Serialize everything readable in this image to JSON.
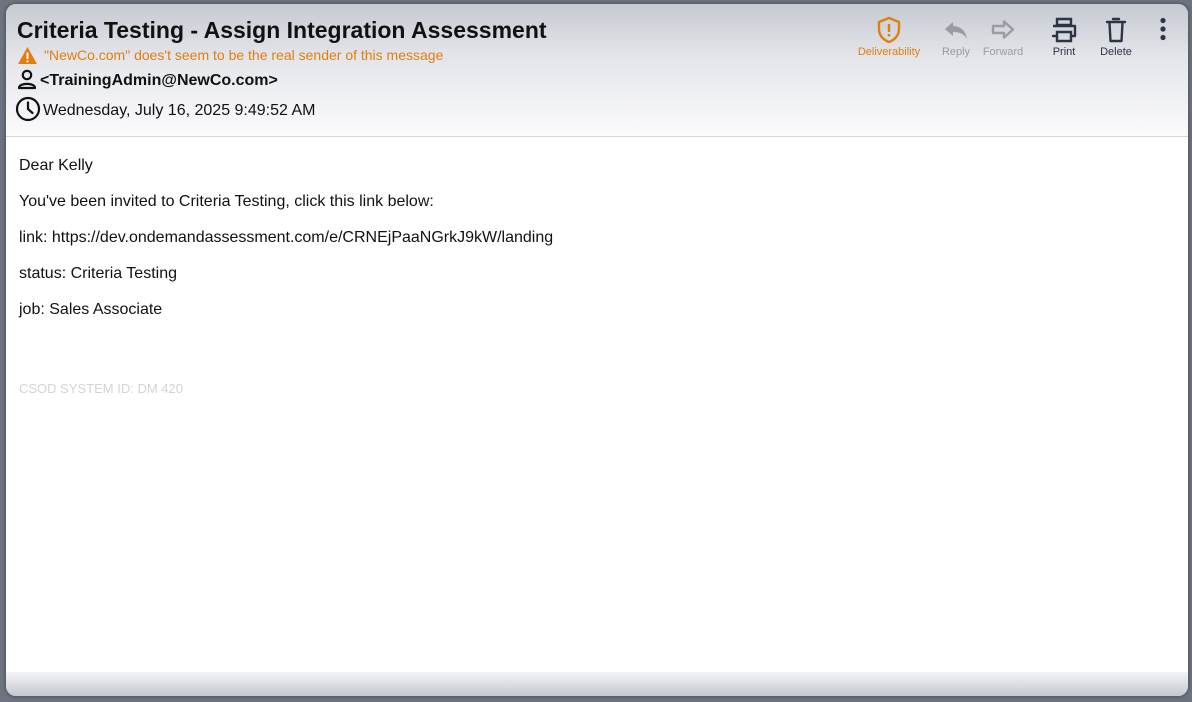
{
  "email": {
    "subject": "Criteria Testing - Assign Integration Assessment",
    "warning": "\"NewCo.com\" does't seem to be the real sender of this message",
    "sender": "<TrainingAdmin@NewCo.com>",
    "date": "Wednesday, July 16, 2025 9:49:52 AM"
  },
  "toolbar": {
    "deliverability_label": "Deliverability",
    "reply_label": "Reply",
    "forward_label": "Forward",
    "print_label": "Print",
    "delete_label": "Delete"
  },
  "body": {
    "greeting": "Dear Kelly",
    "invite": "You've been invited to Criteria Testing, click this link below:",
    "link_line": "link: https://dev.ondemandassessment.com/e/CRNEjPaaNGrkJ9kW/landing",
    "status_line": "status: Criteria Testing",
    "job_line": "job: Sales Associate",
    "system_id": "CSOD SYSTEM ID: DM 420"
  },
  "colors": {
    "warning": "#e07f10",
    "disabled": "#9a9ca2",
    "toolbar_icon": "#2c3445",
    "text": "#111111"
  },
  "icons": {
    "deliverability": "shield-exclamation-icon",
    "reply": "reply-arrow-icon",
    "forward": "forward-arrow-icon",
    "print": "printer-icon",
    "delete": "trash-icon",
    "more": "more-vertical-icon",
    "warning": "warning-triangle-icon",
    "sender": "person-icon",
    "date": "clock-icon"
  }
}
